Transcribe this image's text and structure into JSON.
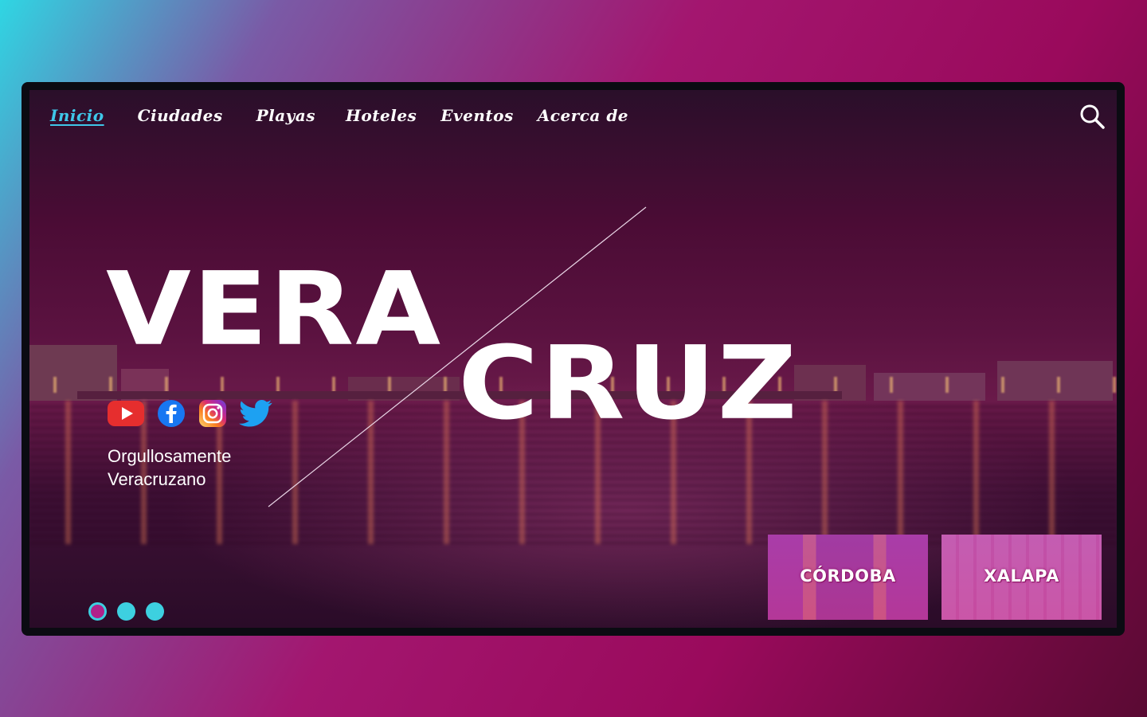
{
  "nav": {
    "items": [
      {
        "label": "Inicio",
        "active": true
      },
      {
        "label": "Ciudades",
        "active": false
      },
      {
        "label": "Playas",
        "active": false
      },
      {
        "label": "Hoteles",
        "active": false
      },
      {
        "label": "Eventos",
        "active": false
      },
      {
        "label": "Acerca de",
        "active": false
      }
    ],
    "search_icon": "search-icon"
  },
  "hero": {
    "title_part1": "VERA",
    "title_part2": "CRUZ",
    "tagline_line1": "Orgullosamente",
    "tagline_line2": "Veracruzano"
  },
  "socials": [
    {
      "icon": "youtube-icon",
      "color": "#e62e2e"
    },
    {
      "icon": "facebook-icon",
      "color": "#1877f2"
    },
    {
      "icon": "instagram-icon",
      "color": "#e1306c"
    },
    {
      "icon": "twitter-icon",
      "color": "#1da1f2"
    }
  ],
  "carousel": {
    "dot_count": 3,
    "active_index": 0
  },
  "cities": [
    {
      "label": "CÓRDOBA"
    },
    {
      "label": "XALAPA"
    }
  ],
  "colors": {
    "accent": "#3fc7e8",
    "brand_magenta": "#a3166f"
  }
}
